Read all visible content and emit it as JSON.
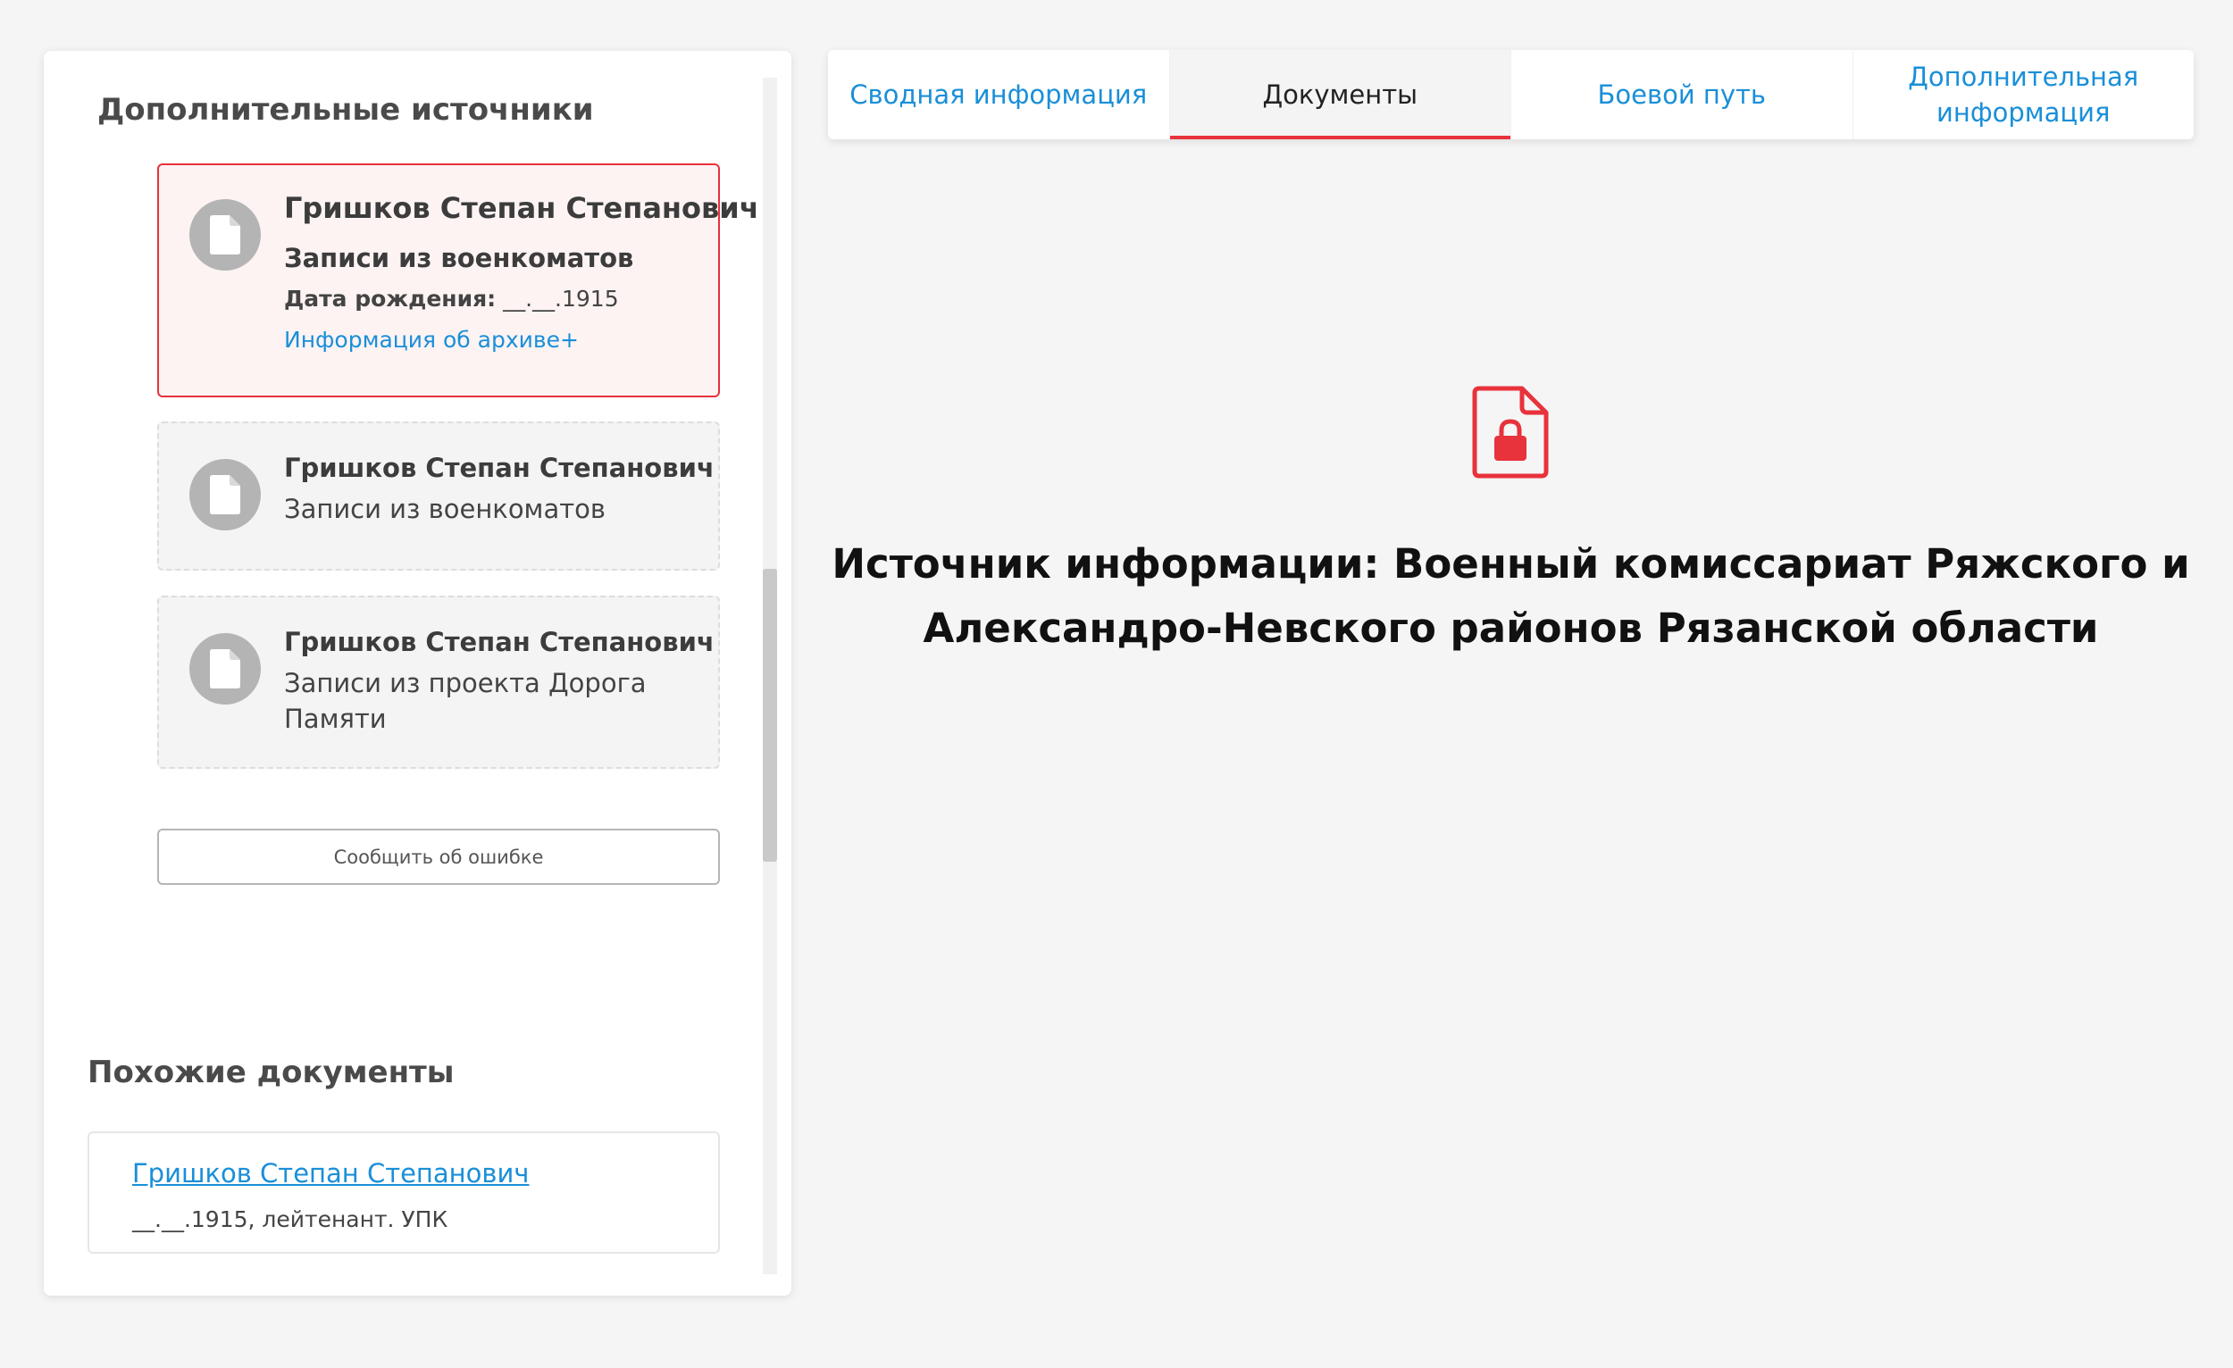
{
  "sidebar": {
    "additional_sources_title": "Дополнительные источники",
    "sources": [
      {
        "name": "Гришков Степан Степанович",
        "source": "Записи из военкоматов",
        "birth_label": "Дата рождения:",
        "birth_value": "__.__.1915",
        "archive_link": "Информация об архиве+",
        "active": true
      },
      {
        "name": "Гришков Степан Степанович",
        "source": "Записи из военкоматов",
        "active": false
      },
      {
        "name": "Гришков Степан Степанович",
        "source": "Записи из проекта Дорога Памяти",
        "active": false
      }
    ],
    "report_error_label": "Сообщить об ошибке",
    "similar_title": "Похожие документы",
    "similar": [
      {
        "name": "Гришков Степан Степанович",
        "meta": "__.__.1915, лейтенант. УПК"
      }
    ]
  },
  "tabs": [
    {
      "label": "Сводная информация",
      "active": false
    },
    {
      "label": "Документы",
      "active": true
    },
    {
      "label": "Боевой путь",
      "active": false
    },
    {
      "label": "Дополнительная информация",
      "active": false
    }
  ],
  "main": {
    "icon": "locked-document-icon",
    "source_info": "Источник информации: Военный комиссариат Ряжского и Александро-Невского районов Рязанской области"
  },
  "colors": {
    "accent_red": "#e8323c",
    "link_blue": "#1a8fd8",
    "icon_grey": "#b4b4b4",
    "background": "#f5f5f5"
  }
}
